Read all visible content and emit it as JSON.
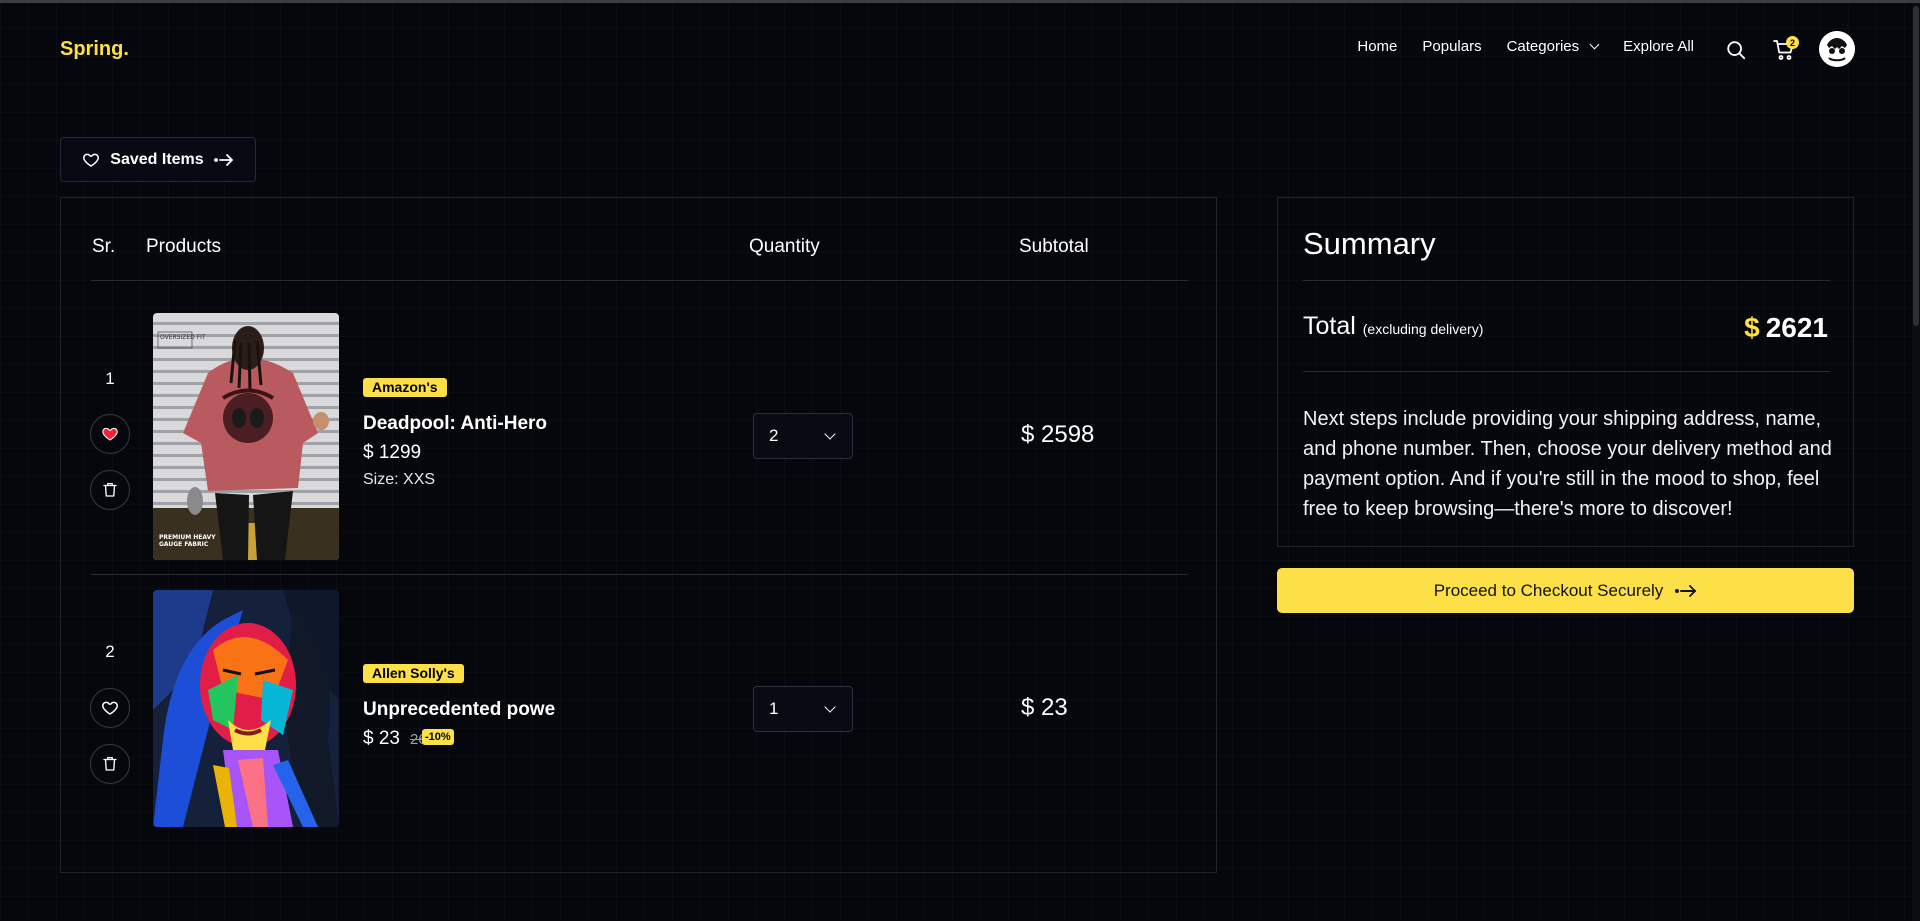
{
  "header": {
    "brand": "Spring.",
    "nav": [
      {
        "label": "Home"
      },
      {
        "label": "Populars"
      },
      {
        "label": "Categories"
      },
      {
        "label": "Explore All"
      }
    ],
    "cart_count": "2"
  },
  "saved": {
    "label": "Saved Items"
  },
  "cart": {
    "columns": {
      "sr": "Sr.",
      "products": "Products",
      "quantity": "Quantity",
      "subtotal": "Subtotal"
    },
    "items": [
      {
        "sr": "1",
        "brand": "Amazon's",
        "name": "Deadpool: Anti-Hero",
        "price": "$ 1299",
        "size": "Size: XXS",
        "quantity": "2",
        "subtotal": "$ 2598",
        "liked": true,
        "image_text_top": "OVERSIZED FIT",
        "image_text_bottom": "PREMIUM HEAVY GAUGE FABRIC"
      },
      {
        "sr": "2",
        "brand": "Allen Solly's",
        "name": "Unprecedented powe",
        "price": "$ 23",
        "old_price": "26",
        "discount": "-10%",
        "quantity": "1",
        "subtotal": "$ 23",
        "liked": false
      }
    ]
  },
  "summary": {
    "title": "Summary",
    "total_label": "Total",
    "total_note": "(excluding delivery)",
    "total_currency": "$",
    "total_value": "2621",
    "text": "Next steps include providing your shipping address, name, and phone number. Then, choose your delivery method and payment option. And if you're still in the mood to shop, feel free to keep browsing—there's more to discover!"
  },
  "checkout": {
    "label": "Proceed to Checkout Securely"
  },
  "colors": {
    "accent": "#fde047",
    "background": "#05070c",
    "border": "#1e2330"
  }
}
